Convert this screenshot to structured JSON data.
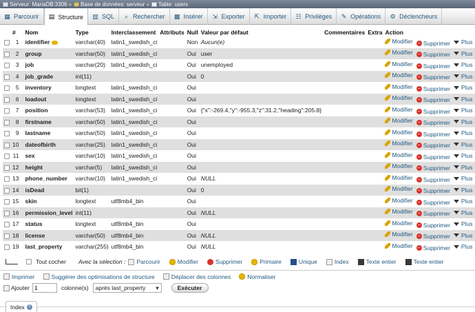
{
  "breadcrumb": {
    "server": "Serveur: MariaDB:3306",
    "database": "Base de données: serveur",
    "table": "Table: users",
    "separator": "»"
  },
  "tabs": [
    {
      "label": "Parcourir",
      "icon": "browse-icon",
      "glyph": "▦"
    },
    {
      "label": "Structure",
      "icon": "structure-icon",
      "glyph": "▤"
    },
    {
      "label": "SQL",
      "icon": "sql-icon",
      "glyph": "▥"
    },
    {
      "label": "Rechercher",
      "icon": "search-icon",
      "glyph": "⌕"
    },
    {
      "label": "Insérer",
      "icon": "insert-icon",
      "glyph": "▩"
    },
    {
      "label": "Exporter",
      "icon": "export-icon",
      "glyph": "⇲"
    },
    {
      "label": "Importer",
      "icon": "import-icon",
      "glyph": "⇱"
    },
    {
      "label": "Privilèges",
      "icon": "privileges-icon",
      "glyph": "☷"
    },
    {
      "label": "Opérations",
      "icon": "operations-icon",
      "glyph": "✎"
    },
    {
      "label": "Déclencheurs",
      "icon": "triggers-icon",
      "glyph": "⚙"
    }
  ],
  "active_tab": 1,
  "columns": {
    "num": "#",
    "name": "Nom",
    "type": "Type",
    "collation": "Interclassement",
    "attributes": "Attributs",
    "null": "Null",
    "default": "Valeur par défaut",
    "comments": "Commentaires",
    "extra": "Extra",
    "action": "Action"
  },
  "actions": {
    "edit": "Modifier",
    "delete": "Supprimer",
    "more": "Plus"
  },
  "rows": [
    {
      "num": "1",
      "name": "identifier",
      "type": "varchar(40)",
      "collation": "latin1_swedish_ci",
      "null": "Non",
      "default": "Aucun(e)",
      "default_italic": true,
      "primary": true
    },
    {
      "num": "2",
      "name": "group",
      "type": "varchar(50)",
      "collation": "latin1_swedish_ci",
      "null": "Oui",
      "default": "user",
      "default_italic": false
    },
    {
      "num": "3",
      "name": "job",
      "type": "varchar(20)",
      "collation": "latin1_swedish_ci",
      "null": "Oui",
      "default": "unemployed",
      "default_italic": false
    },
    {
      "num": "4",
      "name": "job_grade",
      "type": "int(11)",
      "collation": "",
      "null": "Oui",
      "default": "0",
      "default_italic": false
    },
    {
      "num": "5",
      "name": "inventory",
      "type": "longtext",
      "collation": "latin1_swedish_ci",
      "null": "Oui",
      "default": "",
      "default_italic": false
    },
    {
      "num": "6",
      "name": "loadout",
      "type": "longtext",
      "collation": "latin1_swedish_ci",
      "null": "Oui",
      "default": "",
      "default_italic": false
    },
    {
      "num": "7",
      "name": "position",
      "type": "varchar(53)",
      "collation": "latin1_swedish_ci",
      "null": "Oui",
      "default": "{\"x\":-269.4,\"y\":-955.3,\"z\":31.2,\"heading\":205.8}",
      "default_italic": false
    },
    {
      "num": "8",
      "name": "firstname",
      "type": "varchar(50)",
      "collation": "latin1_swedish_ci",
      "null": "Oui",
      "default": "",
      "default_italic": false
    },
    {
      "num": "9",
      "name": "lastname",
      "type": "varchar(50)",
      "collation": "latin1_swedish_ci",
      "null": "Oui",
      "default": "",
      "default_italic": false
    },
    {
      "num": "10",
      "name": "dateofbirth",
      "type": "varchar(25)",
      "collation": "latin1_swedish_ci",
      "null": "Oui",
      "default": "",
      "default_italic": false
    },
    {
      "num": "11",
      "name": "sex",
      "type": "varchar(10)",
      "collation": "latin1_swedish_ci",
      "null": "Oui",
      "default": "",
      "default_italic": false
    },
    {
      "num": "12",
      "name": "height",
      "type": "varchar(5)",
      "collation": "latin1_swedish_ci",
      "null": "Oui",
      "default": "",
      "default_italic": false
    },
    {
      "num": "13",
      "name": "phone_number",
      "type": "varchar(10)",
      "collation": "latin1_swedish_ci",
      "null": "Oui",
      "default": "NULL",
      "default_italic": true
    },
    {
      "num": "14",
      "name": "isDead",
      "type": "bit(1)",
      "collation": "",
      "null": "Oui",
      "default": "0",
      "default_italic": false
    },
    {
      "num": "15",
      "name": "skin",
      "type": "longtext",
      "collation": "utf8mb4_bin",
      "null": "Oui",
      "default": "",
      "default_italic": false
    },
    {
      "num": "16",
      "name": "permission_level",
      "type": "int(11)",
      "collation": "",
      "null": "Oui",
      "default": "NULL",
      "default_italic": true
    },
    {
      "num": "17",
      "name": "status",
      "type": "longtext",
      "collation": "utf8mb4_bin",
      "null": "Oui",
      "default": "",
      "default_italic": false
    },
    {
      "num": "18",
      "name": "license",
      "type": "varchar(50)",
      "collation": "utf8mb4_bin",
      "null": "Oui",
      "default": "NULL",
      "default_italic": true
    },
    {
      "num": "19",
      "name": "last_property",
      "type": "varchar(255)",
      "collation": "utf8mb4_bin",
      "null": "Oui",
      "default": "NULL",
      "default_italic": true
    }
  ],
  "with_selection": {
    "check_all": "Tout cocher",
    "label": "Avec la sélection :",
    "actions": [
      {
        "label": "Parcourir",
        "icon": "browse-icon",
        "cls": ""
      },
      {
        "label": "Modifier",
        "icon": "pencil-icon",
        "cls": "k"
      },
      {
        "label": "Supprimer",
        "icon": "delete-icon",
        "cls": "d"
      },
      {
        "label": "Primaire",
        "icon": "primary-key-icon",
        "cls": "k"
      },
      {
        "label": "Unique",
        "icon": "unique-icon",
        "cls": "u"
      },
      {
        "label": "Index",
        "icon": "index-icon",
        "cls": ""
      },
      {
        "label": "Texte entier",
        "icon": "fulltext-icon",
        "cls": "t"
      },
      {
        "label": "Texte entier",
        "icon": "fulltext-icon",
        "cls": "t"
      }
    ]
  },
  "tools": {
    "print": "Imprimer",
    "suggest": "Suggérer des optimisations de structure",
    "move_columns": "Déplacer des colonnes",
    "normalize": "Normaliser"
  },
  "add_row": {
    "label": "Ajouter",
    "count": "1",
    "columns_label": "colonne(s)",
    "position": "après last_property",
    "execute": "Exécuter"
  },
  "index_tab": {
    "label": "Index"
  }
}
